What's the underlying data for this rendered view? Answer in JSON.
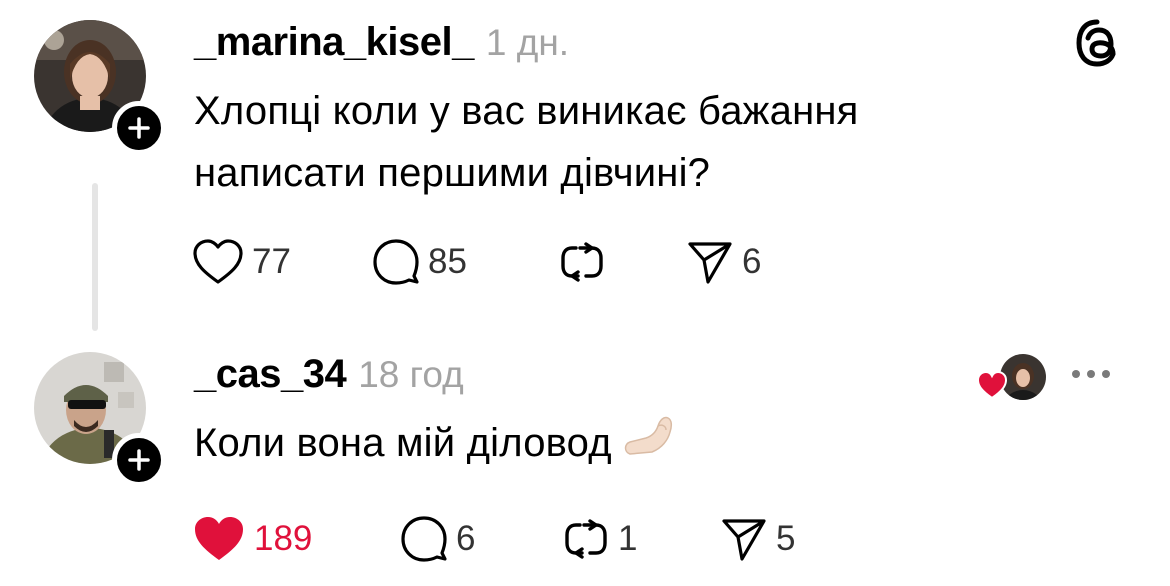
{
  "app_icon": "threads-logo-icon",
  "posts": [
    {
      "username": "_marina_kisel_",
      "time": "1 дн.",
      "text_lines": [
        "Хлопці коли у вас виникає бажання",
        "написати першими дівчині?"
      ],
      "likes": "77",
      "replies": "85",
      "reposts": "",
      "shares": "6",
      "liked": false
    },
    {
      "username": "_cas_34",
      "time": "18 год",
      "text": "Коли вона мій діловод",
      "emoji": "pinched-fingers-emoji",
      "likes": "189",
      "replies": "6",
      "reposts": "1",
      "shares": "5",
      "liked": true
    }
  ],
  "colors": {
    "like_red": "#e0113b",
    "muted_gray": "#a3a3a3",
    "thread_line": "#e5e5e5"
  }
}
